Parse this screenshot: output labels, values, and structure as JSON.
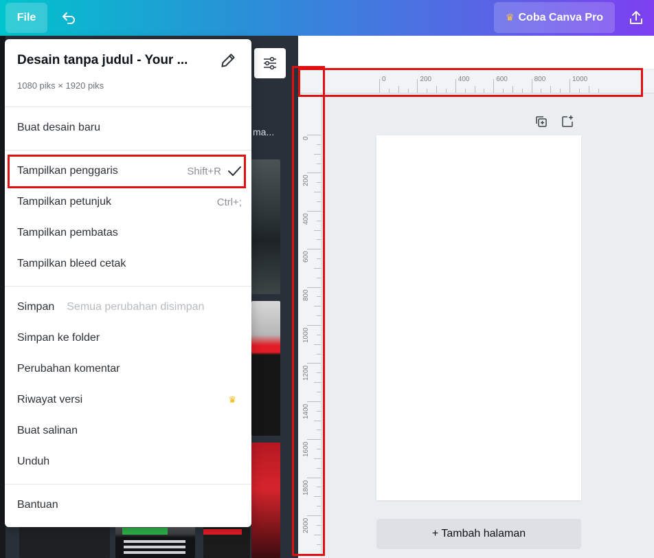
{
  "topbar": {
    "file_label": "File",
    "pro_label": "Coba Canva Pro",
    "pro_icon": "crown-icon",
    "undo_icon": "undo-icon",
    "share_icon": "upload-icon"
  },
  "panel": {
    "heading_fragment": "ma..."
  },
  "menu": {
    "title": "Desain tanpa judul - Your ...",
    "dimensions": "1080 piks × 1920 piks",
    "items": [
      {
        "label": "Buat desain baru"
      },
      {
        "label": "Tampilkan penggaris",
        "shortcut": "Shift+R",
        "checked": true
      },
      {
        "label": "Tampilkan petunjuk",
        "shortcut": "Ctrl+;"
      },
      {
        "label": "Tampilkan pembatas"
      },
      {
        "label": "Tampilkan bleed cetak"
      },
      {
        "label": "Simpan",
        "hint": "Semua perubahan disimpan"
      },
      {
        "label": "Simpan ke folder"
      },
      {
        "label": "Perubahan komentar"
      },
      {
        "label": "Riwayat versi",
        "pro": true
      },
      {
        "label": "Buat salinan"
      },
      {
        "label": "Unduh"
      },
      {
        "label": "Bantuan"
      }
    ]
  },
  "ruler": {
    "horizontal": [
      "0",
      "200",
      "400",
      "600",
      "800",
      "1000"
    ],
    "vertical": [
      "0",
      "200",
      "400",
      "600",
      "800",
      "1000",
      "1200",
      "1400",
      "1600",
      "1800",
      "2000"
    ]
  },
  "editor": {
    "add_page_label": "+ Tambah halaman"
  },
  "colors": {
    "highlight": "#e01010",
    "pro_crown": "#f5b400"
  }
}
